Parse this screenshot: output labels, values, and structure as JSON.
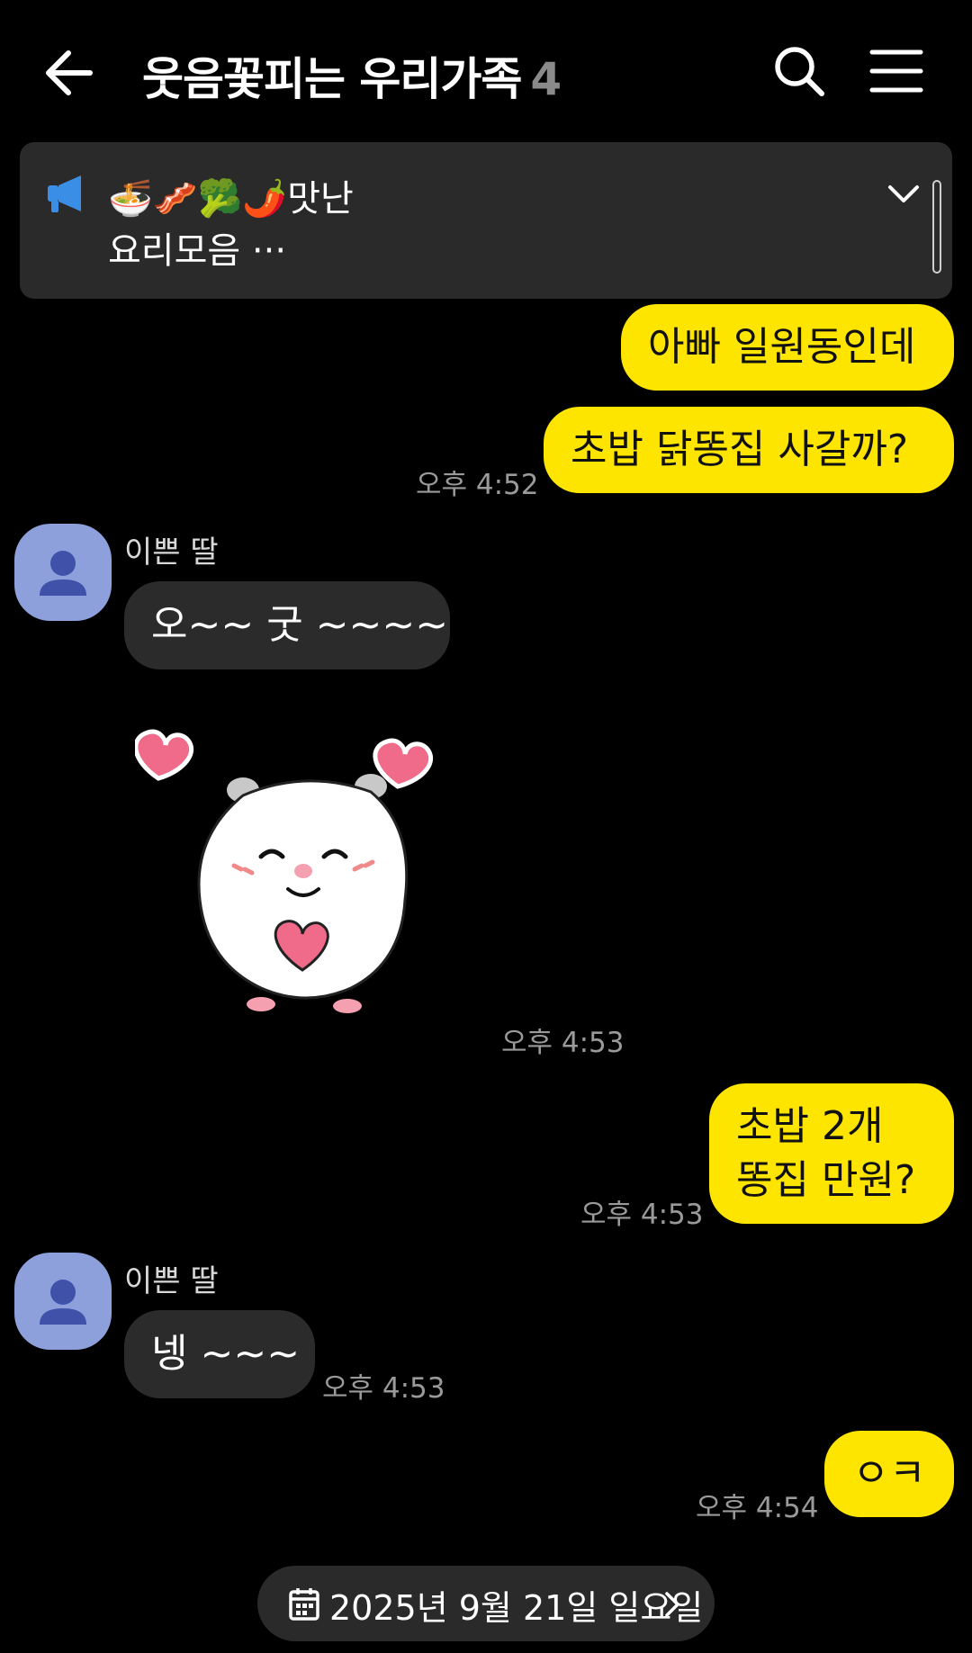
{
  "header": {
    "title": "웃음꽃피는 우리가족",
    "member_count": "4"
  },
  "notice": {
    "line1": "🍜🥓🥦🌶️맛난",
    "line2": "요리모음 ···"
  },
  "messages": [
    {
      "text": "아빠 일원동인데"
    },
    {
      "text": "초밥 닭똥집 사갈까?",
      "time": "오후 4:52"
    },
    {
      "sender": "이쁜 딸",
      "text": "오~~ 굿 ~~~~"
    },
    {
      "sticker": "hamster-heart-sticker",
      "time": "오후 4:53"
    },
    {
      "text_line1": "초밥 2개",
      "text_line2": "똥집 만원?",
      "time": "오후 4:53"
    },
    {
      "sender": "이쁜 딸",
      "text": "넹 ~~~",
      "time": "오후 4:53"
    },
    {
      "text": "ㅇㅋ",
      "time": "오후 4:54"
    }
  ],
  "date_divider": {
    "label": "2025년 9월 21일 일요일"
  },
  "colors": {
    "background": "#000000",
    "my_bubble": "#fee500",
    "their_bubble": "#2b2b2b",
    "avatar": "#8da0dc",
    "notice_icon": "#3a8ee6"
  }
}
